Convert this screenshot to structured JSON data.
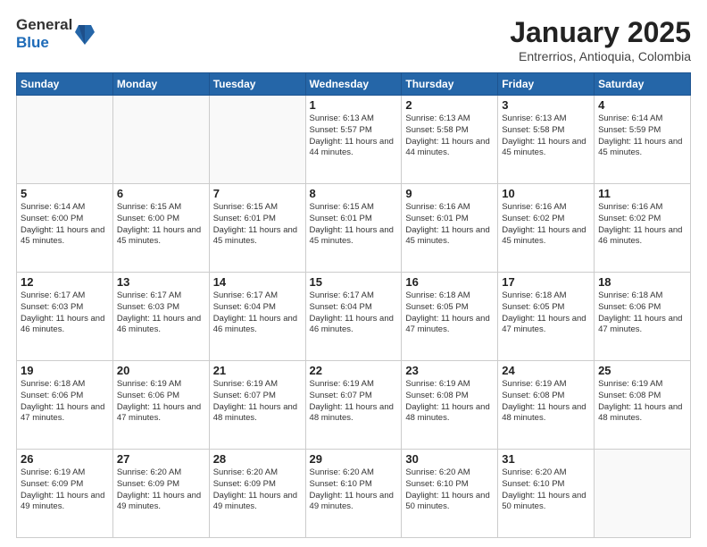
{
  "logo": {
    "general": "General",
    "blue": "Blue"
  },
  "title": "January 2025",
  "location": "Entrerrios, Antioquia, Colombia",
  "weekdays": [
    "Sunday",
    "Monday",
    "Tuesday",
    "Wednesday",
    "Thursday",
    "Friday",
    "Saturday"
  ],
  "weeks": [
    [
      {
        "day": "",
        "info": ""
      },
      {
        "day": "",
        "info": ""
      },
      {
        "day": "",
        "info": ""
      },
      {
        "day": "1",
        "sunrise": "Sunrise: 6:13 AM",
        "sunset": "Sunset: 5:57 PM",
        "daylight": "Daylight: 11 hours and 44 minutes."
      },
      {
        "day": "2",
        "sunrise": "Sunrise: 6:13 AM",
        "sunset": "Sunset: 5:58 PM",
        "daylight": "Daylight: 11 hours and 44 minutes."
      },
      {
        "day": "3",
        "sunrise": "Sunrise: 6:13 AM",
        "sunset": "Sunset: 5:58 PM",
        "daylight": "Daylight: 11 hours and 45 minutes."
      },
      {
        "day": "4",
        "sunrise": "Sunrise: 6:14 AM",
        "sunset": "Sunset: 5:59 PM",
        "daylight": "Daylight: 11 hours and 45 minutes."
      }
    ],
    [
      {
        "day": "5",
        "sunrise": "Sunrise: 6:14 AM",
        "sunset": "Sunset: 6:00 PM",
        "daylight": "Daylight: 11 hours and 45 minutes."
      },
      {
        "day": "6",
        "sunrise": "Sunrise: 6:15 AM",
        "sunset": "Sunset: 6:00 PM",
        "daylight": "Daylight: 11 hours and 45 minutes."
      },
      {
        "day": "7",
        "sunrise": "Sunrise: 6:15 AM",
        "sunset": "Sunset: 6:01 PM",
        "daylight": "Daylight: 11 hours and 45 minutes."
      },
      {
        "day": "8",
        "sunrise": "Sunrise: 6:15 AM",
        "sunset": "Sunset: 6:01 PM",
        "daylight": "Daylight: 11 hours and 45 minutes."
      },
      {
        "day": "9",
        "sunrise": "Sunrise: 6:16 AM",
        "sunset": "Sunset: 6:01 PM",
        "daylight": "Daylight: 11 hours and 45 minutes."
      },
      {
        "day": "10",
        "sunrise": "Sunrise: 6:16 AM",
        "sunset": "Sunset: 6:02 PM",
        "daylight": "Daylight: 11 hours and 45 minutes."
      },
      {
        "day": "11",
        "sunrise": "Sunrise: 6:16 AM",
        "sunset": "Sunset: 6:02 PM",
        "daylight": "Daylight: 11 hours and 46 minutes."
      }
    ],
    [
      {
        "day": "12",
        "sunrise": "Sunrise: 6:17 AM",
        "sunset": "Sunset: 6:03 PM",
        "daylight": "Daylight: 11 hours and 46 minutes."
      },
      {
        "day": "13",
        "sunrise": "Sunrise: 6:17 AM",
        "sunset": "Sunset: 6:03 PM",
        "daylight": "Daylight: 11 hours and 46 minutes."
      },
      {
        "day": "14",
        "sunrise": "Sunrise: 6:17 AM",
        "sunset": "Sunset: 6:04 PM",
        "daylight": "Daylight: 11 hours and 46 minutes."
      },
      {
        "day": "15",
        "sunrise": "Sunrise: 6:17 AM",
        "sunset": "Sunset: 6:04 PM",
        "daylight": "Daylight: 11 hours and 46 minutes."
      },
      {
        "day": "16",
        "sunrise": "Sunrise: 6:18 AM",
        "sunset": "Sunset: 6:05 PM",
        "daylight": "Daylight: 11 hours and 47 minutes."
      },
      {
        "day": "17",
        "sunrise": "Sunrise: 6:18 AM",
        "sunset": "Sunset: 6:05 PM",
        "daylight": "Daylight: 11 hours and 47 minutes."
      },
      {
        "day": "18",
        "sunrise": "Sunrise: 6:18 AM",
        "sunset": "Sunset: 6:06 PM",
        "daylight": "Daylight: 11 hours and 47 minutes."
      }
    ],
    [
      {
        "day": "19",
        "sunrise": "Sunrise: 6:18 AM",
        "sunset": "Sunset: 6:06 PM",
        "daylight": "Daylight: 11 hours and 47 minutes."
      },
      {
        "day": "20",
        "sunrise": "Sunrise: 6:19 AM",
        "sunset": "Sunset: 6:06 PM",
        "daylight": "Daylight: 11 hours and 47 minutes."
      },
      {
        "day": "21",
        "sunrise": "Sunrise: 6:19 AM",
        "sunset": "Sunset: 6:07 PM",
        "daylight": "Daylight: 11 hours and 48 minutes."
      },
      {
        "day": "22",
        "sunrise": "Sunrise: 6:19 AM",
        "sunset": "Sunset: 6:07 PM",
        "daylight": "Daylight: 11 hours and 48 minutes."
      },
      {
        "day": "23",
        "sunrise": "Sunrise: 6:19 AM",
        "sunset": "Sunset: 6:08 PM",
        "daylight": "Daylight: 11 hours and 48 minutes."
      },
      {
        "day": "24",
        "sunrise": "Sunrise: 6:19 AM",
        "sunset": "Sunset: 6:08 PM",
        "daylight": "Daylight: 11 hours and 48 minutes."
      },
      {
        "day": "25",
        "sunrise": "Sunrise: 6:19 AM",
        "sunset": "Sunset: 6:08 PM",
        "daylight": "Daylight: 11 hours and 48 minutes."
      }
    ],
    [
      {
        "day": "26",
        "sunrise": "Sunrise: 6:19 AM",
        "sunset": "Sunset: 6:09 PM",
        "daylight": "Daylight: 11 hours and 49 minutes."
      },
      {
        "day": "27",
        "sunrise": "Sunrise: 6:20 AM",
        "sunset": "Sunset: 6:09 PM",
        "daylight": "Daylight: 11 hours and 49 minutes."
      },
      {
        "day": "28",
        "sunrise": "Sunrise: 6:20 AM",
        "sunset": "Sunset: 6:09 PM",
        "daylight": "Daylight: 11 hours and 49 minutes."
      },
      {
        "day": "29",
        "sunrise": "Sunrise: 6:20 AM",
        "sunset": "Sunset: 6:10 PM",
        "daylight": "Daylight: 11 hours and 49 minutes."
      },
      {
        "day": "30",
        "sunrise": "Sunrise: 6:20 AM",
        "sunset": "Sunset: 6:10 PM",
        "daylight": "Daylight: 11 hours and 50 minutes."
      },
      {
        "day": "31",
        "sunrise": "Sunrise: 6:20 AM",
        "sunset": "Sunset: 6:10 PM",
        "daylight": "Daylight: 11 hours and 50 minutes."
      },
      {
        "day": "",
        "info": ""
      }
    ]
  ]
}
